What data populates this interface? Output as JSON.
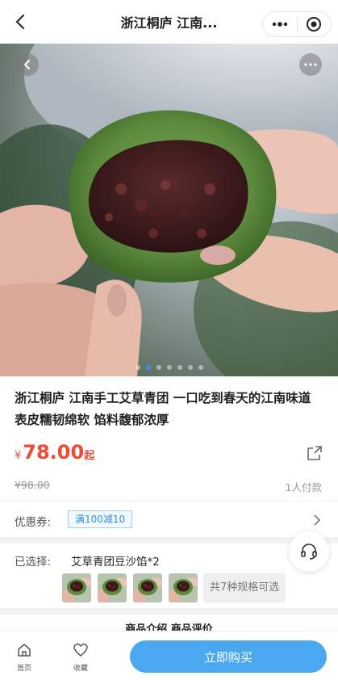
{
  "nav": {
    "title": "浙江桐庐 江南...",
    "back_icon": "back-arrow-icon",
    "more_icon": "more-dots-icon",
    "close_icon": "target-circle-icon"
  },
  "hero": {
    "image_count": 7,
    "active_index": 1,
    "back_icon": "back-circle-icon",
    "more_icon": "more-circle-icon",
    "accent_color": "#3b8de8"
  },
  "product": {
    "title": "浙江桐庐 江南手工艾草青团 一口吃到春天的江南味道 表皮糯韧绵软 馅料馥郁浓厚",
    "currency": "¥",
    "price": "78.00",
    "price_suffix": "起",
    "original_price": "¥98.00",
    "paid_count": "1人付款",
    "price_color": "#ef4b36",
    "share_icon": "share-icon"
  },
  "coupon": {
    "label": "优惠券:",
    "tag": "满100减10",
    "arrow_icon": "chevron-right-icon"
  },
  "selection": {
    "label": "已选择:",
    "value": "艾草青团豆沙馅*2",
    "thumbnail_count": 4,
    "more_specs": "共7种规格可选"
  },
  "service_icon": "headset-icon",
  "next_section": {
    "text": "商品介绍 商品评价"
  },
  "bottom_bar": {
    "home_label": "首页",
    "home_icon": "home-icon",
    "fav_label": "收藏",
    "fav_icon": "heart-icon",
    "buy_label": "立即购买",
    "buy_color": "#4aa8f1"
  }
}
